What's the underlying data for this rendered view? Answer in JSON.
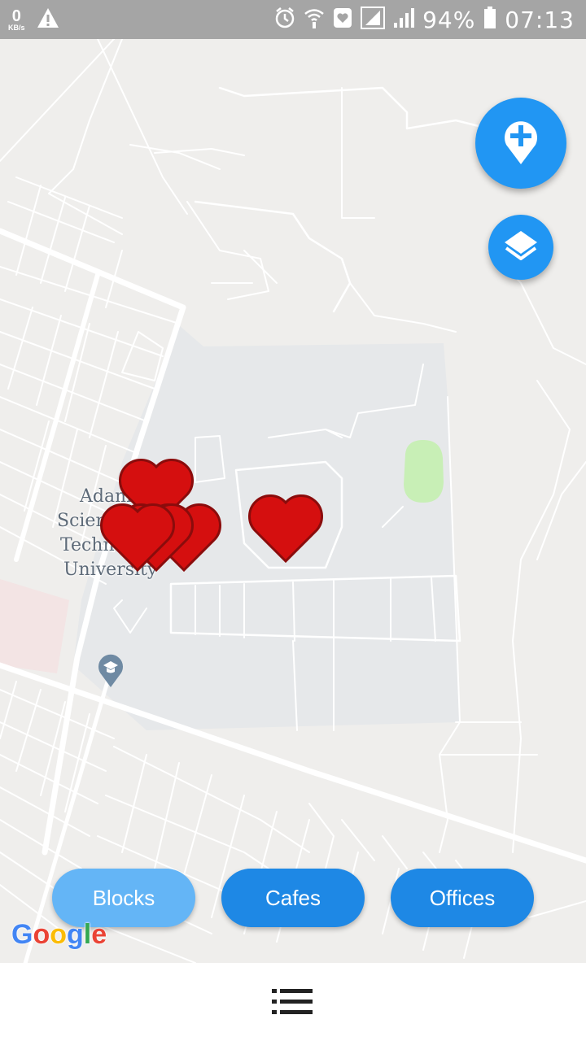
{
  "status_bar": {
    "net_speed_value": "0",
    "net_speed_unit": "KB/s",
    "battery": "94%",
    "time": "07:13",
    "icons": [
      "warning-icon",
      "alarm-icon",
      "wifi-icon",
      "heart-status-icon",
      "signal-icon",
      "signal-icon",
      "battery-icon"
    ]
  },
  "map": {
    "place_label_lines": [
      "Adam",
      "Scien",
      "Techn",
      "University"
    ],
    "place_icon": "graduation-cap-icon",
    "markers": [
      "heart-marker",
      "heart-marker",
      "heart-marker",
      "heart-marker",
      "heart-marker"
    ],
    "colors": {
      "marker": "#d50f0f",
      "campus": "#e6e8ea",
      "field": "#c8efb6",
      "accent": "#2196f3"
    }
  },
  "fabs": {
    "add_icon": "add-location-icon",
    "layers_icon": "layers-icon"
  },
  "filters": {
    "blocks": "Blocks",
    "cafes": "Cafes",
    "offices": "Offices"
  },
  "google": {
    "logo": "Google"
  },
  "bottom_bar": {
    "menu_icon": "list-icon"
  }
}
